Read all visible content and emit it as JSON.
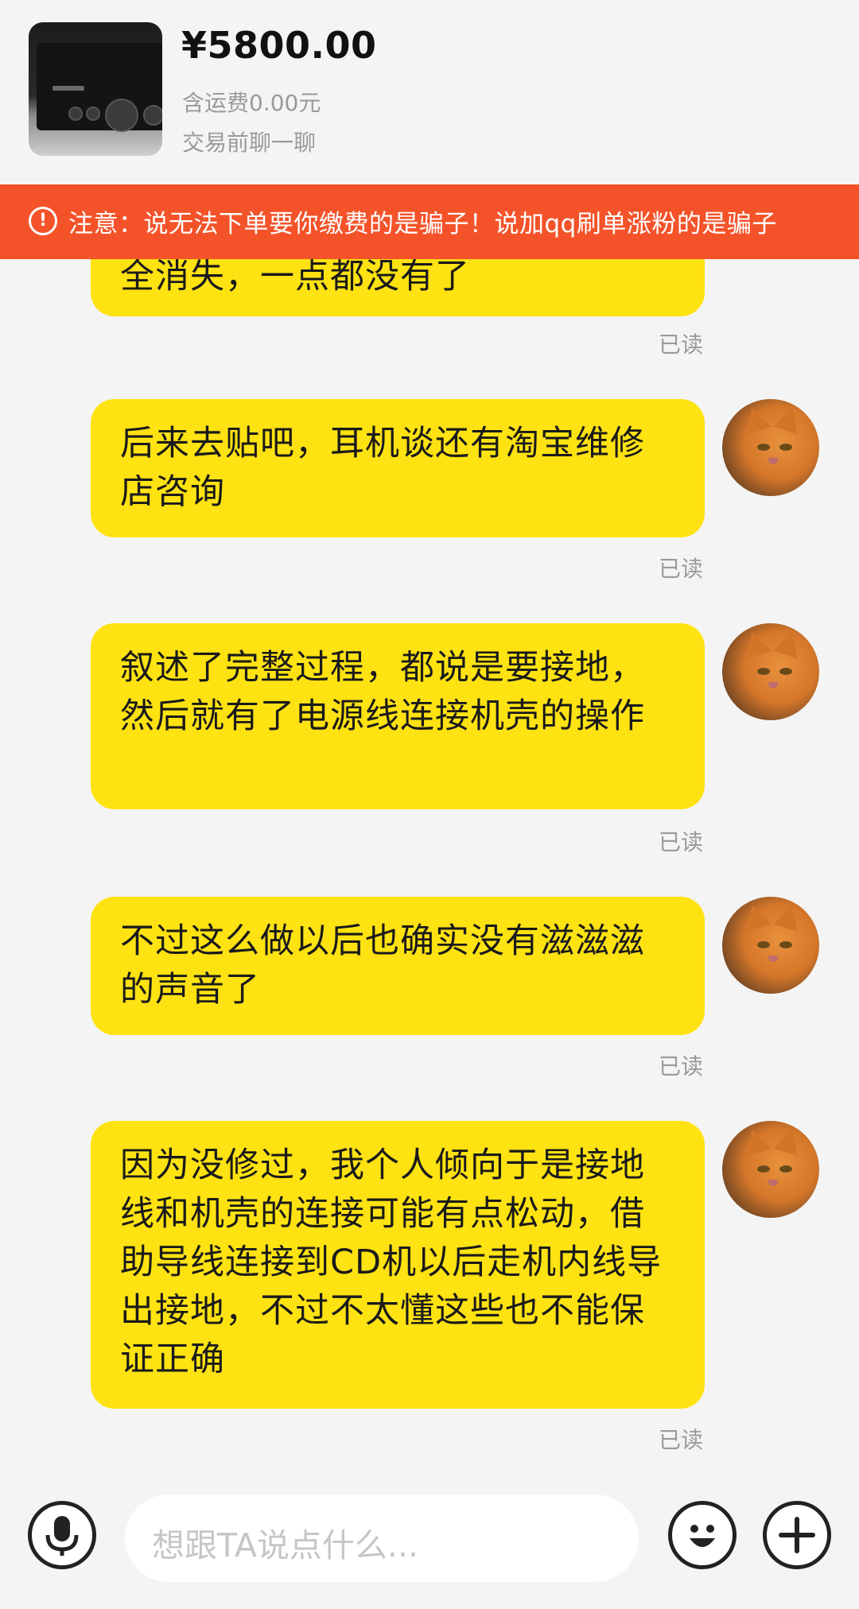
{
  "header": {
    "price": "¥5800.00",
    "shipping": "含运费0.00元",
    "prechat": "交易前聊一聊"
  },
  "warning": {
    "icon": "exclamation-circle-icon",
    "text": "注意：说无法下单要你缴费的是骗子！说加qq刷单涨粉的是骗子"
  },
  "messages": [
    {
      "text": "全消失，一点都没有了",
      "status": "已读"
    },
    {
      "text": "后来去贴吧，耳机谈还有淘宝维修店咨询",
      "status": "已读"
    },
    {
      "text": "叙述了完整过程，都说是要接地，然后就有了电源线连接机壳的操作",
      "status": "已读"
    },
    {
      "text": "不过这么做以后也确实没有滋滋滋的声音了",
      "status": "已读"
    },
    {
      "text": "因为没修过，我个人倾向于是接地线和机壳的连接可能有点松动，借助导线连接到CD机以后走机内线导出接地，不过不太懂这些也不能保证正确",
      "status": "已读"
    }
  ],
  "input": {
    "placeholder": "想跟TA说点什么...",
    "voice_icon": "microphone-icon",
    "emoji_icon": "emoji-icon",
    "plus_icon": "plus-icon"
  },
  "colors": {
    "bubble": "#ffe212",
    "warning_bar": "#f4532a",
    "background": "#f4f4f4"
  }
}
